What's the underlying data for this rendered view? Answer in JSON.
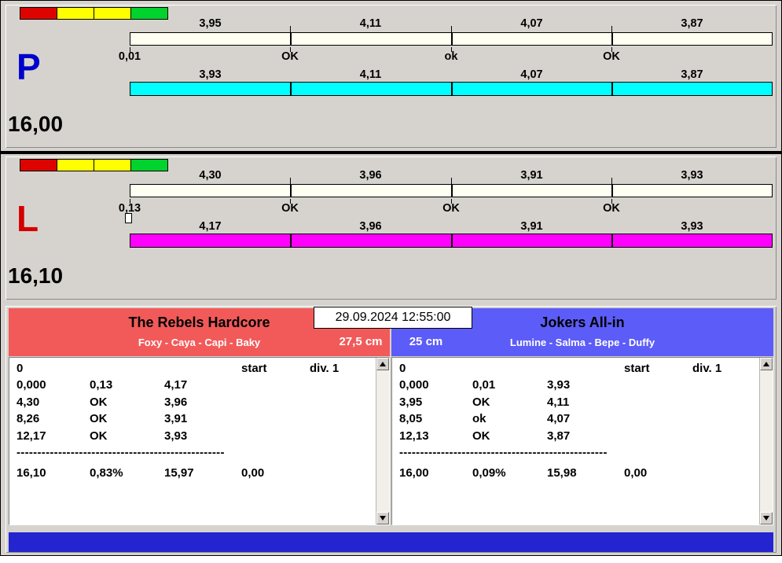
{
  "window": {
    "bg": "#d6d3ce",
    "timestamp": "29.09.2024 12:55:00",
    "footer_color": "#2424d0"
  },
  "lanes": [
    {
      "letter": "P",
      "letter_color": "#0000cc",
      "total": "16,00",
      "status_colors": [
        "#dd0400",
        "#ffff00",
        "#ffff00",
        "#00d22e"
      ],
      "top_bar_color": "#fffff2",
      "top_segments": [
        "3,95",
        "4,11",
        "4,07",
        "3,87"
      ],
      "check_labels": [
        "0,01",
        "OK",
        "ok",
        "OK"
      ],
      "bottom_bar_color": "#00ffff",
      "bottom_segments": [
        "3,93",
        "4,11",
        "4,07",
        "3,87"
      ]
    },
    {
      "letter": "L",
      "letter_color": "#d40000",
      "total": "16,10",
      "status_colors": [
        "#dd0400",
        "#ffff00",
        "#ffff00",
        "#00d22e"
      ],
      "top_bar_color": "#fffff2",
      "top_segments": [
        "4,30",
        "3,96",
        "3,91",
        "3,93"
      ],
      "check_labels": [
        "0,13",
        "OK",
        "OK",
        "OK"
      ],
      "bottom_bar_color": "#ff00ff",
      "bottom_segments": [
        "4,17",
        "3,96",
        "3,91",
        "3,93"
      ]
    }
  ],
  "teams": [
    {
      "name": "The Rebels Hardcore",
      "members": "Foxy - Caya - Capi - Baky",
      "header_color": "#f25a5a",
      "distance": "27,5 cm",
      "table": {
        "first_cell": "0",
        "start_label": "start",
        "div_label": "div. 1",
        "rows": [
          [
            "0,000",
            "0,13",
            "4,17"
          ],
          [
            "4,30",
            "OK",
            "3,96"
          ],
          [
            "8,26",
            "OK",
            "3,91"
          ],
          [
            "12,17",
            "OK",
            "3,93"
          ]
        ],
        "separator": "--------------------------------------------------",
        "totals": [
          "16,10",
          "0,83%",
          "15,97",
          "0,00"
        ]
      }
    },
    {
      "name": "Jokers All-in",
      "members": "Lumine - Salma - Bepe - Duffy",
      "header_color": "#5c5cf8",
      "distance": "25 cm",
      "table": {
        "first_cell": "0",
        "start_label": "start",
        "div_label": "div. 1",
        "rows": [
          [
            "0,000",
            "0,01",
            "3,93"
          ],
          [
            "3,95",
            "OK",
            "4,11"
          ],
          [
            "8,05",
            "ok",
            "4,07"
          ],
          [
            "12,13",
            "OK",
            "3,87"
          ]
        ],
        "separator": "--------------------------------------------------",
        "totals": [
          "16,00",
          "0,09%",
          "15,98",
          "0,00"
        ]
      }
    }
  ]
}
